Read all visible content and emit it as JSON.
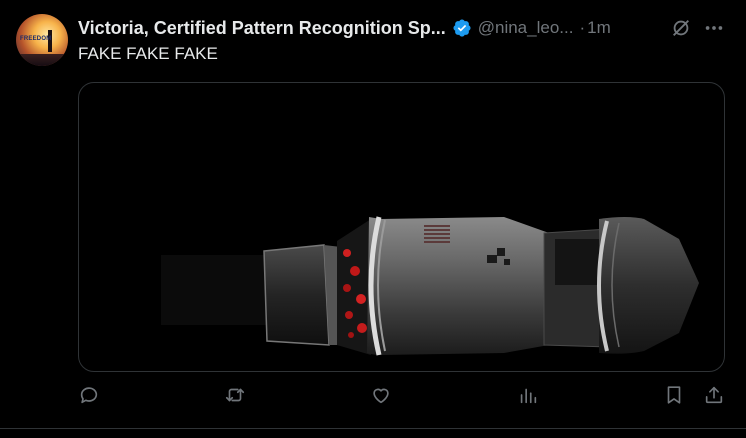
{
  "post": {
    "author": {
      "name": "Victoria, Certified Pattern Recognition Sp...",
      "handle": "@nina_leo...",
      "verified": true,
      "avatar_icon": "sunset-silhouette-avatar",
      "avatar_text": "FREEDOM"
    },
    "separator": "·",
    "time": "1m",
    "text": "FAKE FAKE FAKE",
    "media": {
      "kind": "video-still",
      "subject": "spacecraft-capsule-render"
    },
    "header_icons": [
      "grok-icon",
      "more-icon"
    ],
    "actions": [
      {
        "name": "reply-icon"
      },
      {
        "name": "repost-icon"
      },
      {
        "name": "like-icon"
      },
      {
        "name": "views-icon"
      },
      {
        "name": "bookmark-icon"
      },
      {
        "name": "share-icon"
      }
    ]
  },
  "colors": {
    "background": "#000000",
    "text_primary": "#e7e9ea",
    "text_secondary": "#71767b",
    "verified_blue": "#1d9bf0",
    "border": "#2f3336"
  }
}
